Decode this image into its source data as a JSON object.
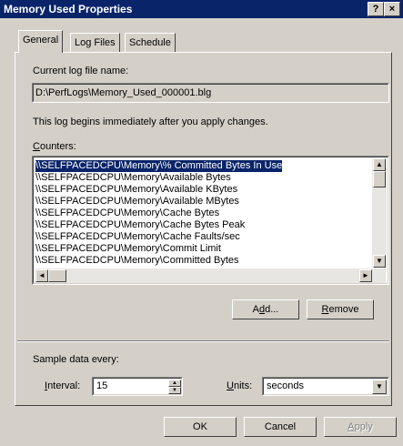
{
  "window": {
    "title": "Memory Used Properties",
    "help_label": "?",
    "close_label": "×"
  },
  "tabs": [
    {
      "label": "General",
      "active": true
    },
    {
      "label": "Log Files",
      "active": false
    },
    {
      "label": "Schedule",
      "active": false
    }
  ],
  "general": {
    "log_name_label": "Current log file name:",
    "log_name_value": "D:\\PerfLogs\\Memory_Used_000001.blg",
    "info_text": "This log begins immediately after you apply changes.",
    "counters_label_key": "C",
    "counters_label_rest": "ounters:",
    "counters": [
      "\\\\SELFPACEDCPU\\Memory\\% Committed Bytes In Use",
      "\\\\SELFPACEDCPU\\Memory\\Available Bytes",
      "\\\\SELFPACEDCPU\\Memory\\Available KBytes",
      "\\\\SELFPACEDCPU\\Memory\\Available MBytes",
      "\\\\SELFPACEDCPU\\Memory\\Cache Bytes",
      "\\\\SELFPACEDCPU\\Memory\\Cache Bytes Peak",
      "\\\\SELFPACEDCPU\\Memory\\Cache Faults/sec",
      "\\\\SELFPACEDCPU\\Memory\\Commit Limit",
      "\\\\SELFPACEDCPU\\Memory\\Committed Bytes"
    ],
    "selected_counter_index": 0,
    "add_prefix": "A",
    "add_key": "d",
    "add_suffix": "d...",
    "remove_key": "R",
    "remove_rest": "emove",
    "sample_label": "Sample data every:",
    "interval_key": "I",
    "interval_rest": "nterval:",
    "interval_value": "15",
    "units_key": "U",
    "units_rest": "nits:",
    "units_value": "seconds"
  },
  "footer": {
    "ok": "OK",
    "cancel": "Cancel",
    "apply_key": "A",
    "apply_rest": "pply"
  },
  "icons": {
    "scroll_up": "▲",
    "scroll_down": "▼",
    "scroll_left": "◄",
    "scroll_right": "►",
    "spin_up": "▲",
    "spin_down": "▼",
    "dropdown": "▼"
  }
}
